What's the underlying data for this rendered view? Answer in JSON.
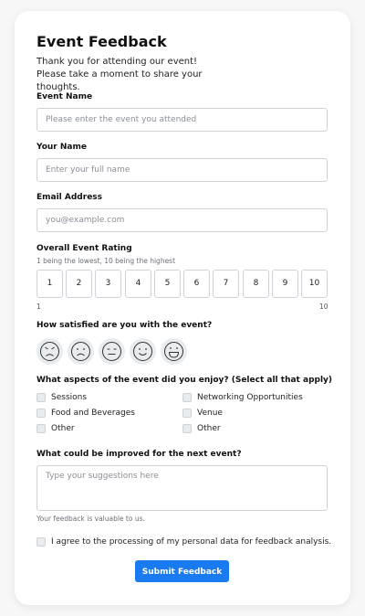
{
  "form": {
    "title": "Event Feedback",
    "intro": "Thank you for attending our event! Please take a moment to share your thoughts.",
    "event_name": {
      "label": "Event Name",
      "placeholder": "Please enter the event you attended"
    },
    "your_name": {
      "label": "Your Name",
      "placeholder": "Enter your full name"
    },
    "email": {
      "label": "Email Address",
      "placeholder": "you@example.com"
    },
    "rating": {
      "label": "Overall Event Rating",
      "helper": "1 being the lowest, 10 being the highest",
      "options": [
        "1",
        "2",
        "3",
        "4",
        "5",
        "6",
        "7",
        "8",
        "9",
        "10"
      ],
      "min_label": "1",
      "max_label": "10"
    },
    "satisfaction": {
      "label": "How satisfied are you with the event?",
      "faces": [
        "angry-face-icon",
        "sad-face-icon",
        "neutral-face-icon",
        "smile-face-icon",
        "big-smile-face-icon"
      ]
    },
    "aspects": {
      "label": "What aspects of the event did you enjoy? (Select all that apply)",
      "left": [
        "Sessions",
        "Food and Beverages",
        "Other"
      ],
      "right": [
        "Networking Opportunities",
        "Venue",
        "Other"
      ]
    },
    "improve": {
      "label": "What could be improved for the next event?",
      "placeholder": "Type your suggestions here",
      "helper": "Your feedback is valuable to us."
    },
    "consent": "I agree to the processing of my personal data for feedback analysis.",
    "submit": "Submit Feedback"
  },
  "colors": {
    "accent": "#1a7bf0",
    "border": "#cfd3d8",
    "muted_bg": "#e9ecef"
  }
}
